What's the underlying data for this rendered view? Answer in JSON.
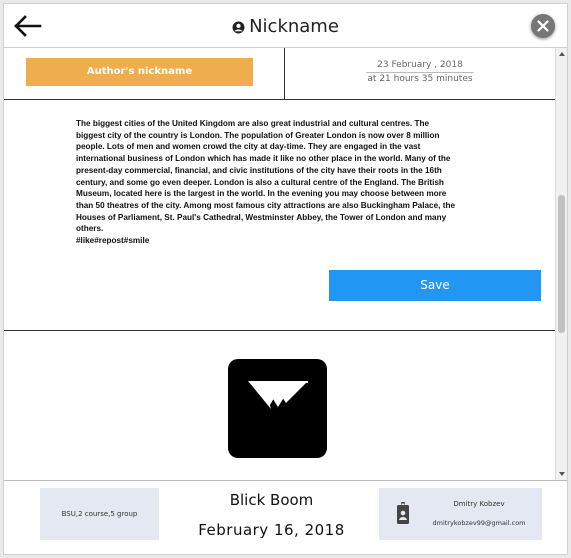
{
  "header": {
    "title": "Nickname",
    "back_icon": "arrow-left-icon",
    "user_icon": "account-circle-icon",
    "close_icon": "close-icon"
  },
  "post": {
    "author_button_label": "Author's  nickname",
    "date_line1": "23 February , 2018",
    "date_line2": "at 21 hours 35 minutes",
    "text": "The biggest cities of the United Kingdom are also great industrial and cultural centres. The biggest city of the country is London. The population of Greater London is now over 8 million people. Lots of men and women crowd the city at day-time. They are engaged in the vast international business of London which has made it like no other place in the world. Many of the present-day commercial, financial, and civic institutions of the city have their roots in the 16th century, and some go even deeper. London is also a cultural centre of the England. The British Museum, located here is the largest in the world. In the evening you may choose between more than 50 theatres of the city. Among most famous city attractions are also Buckingham Palace, the Houses of Parliament, St. Paul's Cathedral, Westminster Abbey, the Tower of London and many others.",
    "hashtags": "#like#repost#smile",
    "save_label": "Save",
    "image_icon": "image-placeholder-icon"
  },
  "footer": {
    "left_text": "BSU,2 course,5 group",
    "title": "Blick Boom",
    "date": "February 16, 2018",
    "contact_icon": "badge-icon",
    "contact_name": "Dmitry Kobzev",
    "contact_email": "dmitrykobzev99@gmail.com"
  },
  "colors": {
    "accent_orange": "#f0ad4e",
    "save_blue": "#2196f3",
    "footer_card": "#e4e8f2",
    "close_grey": "#777777"
  }
}
